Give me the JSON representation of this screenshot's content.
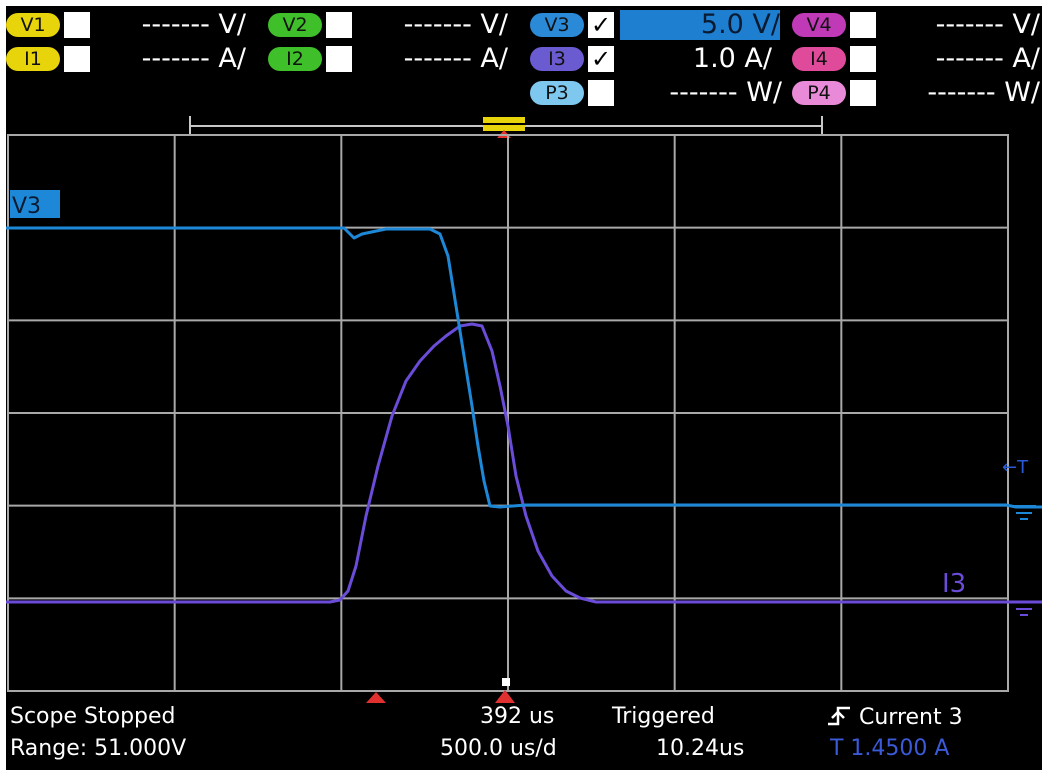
{
  "channels": {
    "v1": {
      "label": "V1",
      "value": "------- V/",
      "pill": "#e8d40a",
      "checked": false
    },
    "i1": {
      "label": "I1",
      "value": "------- A/",
      "pill": "#e8d40a",
      "checked": false
    },
    "v2": {
      "label": "V2",
      "value": "------- V/",
      "pill": "#3fbf2a",
      "checked": false
    },
    "i2": {
      "label": "I2",
      "value": "------- A/",
      "pill": "#3fbf2a",
      "checked": false
    },
    "v3": {
      "label": "V3",
      "value": "5.0 V/",
      "pill": "#2a8ad8",
      "checked": true,
      "check": "✓"
    },
    "i3": {
      "label": "I3",
      "value": "1.0 A/",
      "pill": "#6b5bd0",
      "checked": true,
      "check": "✓"
    },
    "p3": {
      "label": "P3",
      "value": "------- W/",
      "pill": "#7ec8f0",
      "checked": false
    },
    "v4": {
      "label": "V4",
      "value": "------- V/",
      "pill": "#c03ab8",
      "checked": false
    },
    "i4": {
      "label": "I4",
      "value": "------- A/",
      "pill": "#e04a9a",
      "checked": false
    },
    "p4": {
      "label": "P4",
      "value": "------- W/",
      "pill": "#e88ad8",
      "checked": false
    }
  },
  "traces": {
    "v3": {
      "label": "V3",
      "color": "#1e88d8"
    },
    "i3": {
      "label": "I3",
      "color": "#6a4cd8"
    }
  },
  "status": {
    "scope_state": "Scope Stopped",
    "range": "Range: 51.000V",
    "delay": "392 us",
    "timebase": "500.0 us/d",
    "trigger_state": "Triggered",
    "trigger_time": "10.24us",
    "trigger_source": "Current 3",
    "trigger_level": "T 1.4500 A"
  },
  "markers": {
    "trigger_level": "←T",
    "i3_ground": "I3"
  },
  "colors": {
    "grid": "#a8a8a8",
    "background": "#000000",
    "trigger_marker": "#e03030",
    "trigger_level_text": "#3a5ad8"
  }
}
